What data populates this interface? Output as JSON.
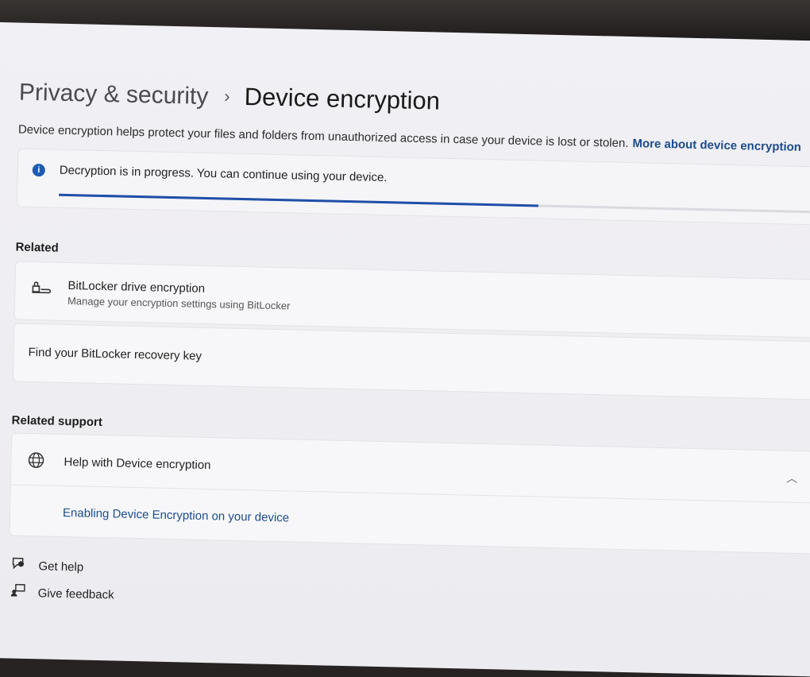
{
  "breadcrumb": {
    "parent": "Privacy & security",
    "separator": "›",
    "current": "Device encryption"
  },
  "description": {
    "text": "Device encryption helps protect your files and folders from unauthorized access in case your device is lost or stolen.",
    "link": "More about device encryption"
  },
  "status": {
    "icon": "info-icon",
    "message": "Decryption is in progress. You can continue using your device.",
    "progress": 0.61
  },
  "related": {
    "heading": "Related",
    "bitlocker": {
      "icon": "bitlocker-key-icon",
      "title": "BitLocker drive encryption",
      "subtitle": "Manage your encryption settings using BitLocker"
    },
    "recovery": {
      "title": "Find your BitLocker recovery key"
    }
  },
  "related_support": {
    "heading": "Related support",
    "help": {
      "icon": "globe-icon",
      "title": "Help with Device encryption"
    },
    "link": "Enabling Device Encryption on your device"
  },
  "footer": {
    "get_help": {
      "icon": "help-chat-icon",
      "label": "Get help"
    },
    "feedback": {
      "icon": "feedback-icon",
      "label": "Give feedback"
    }
  },
  "colors": {
    "accent": "#1f4fa8",
    "link": "#1c4c8c"
  }
}
